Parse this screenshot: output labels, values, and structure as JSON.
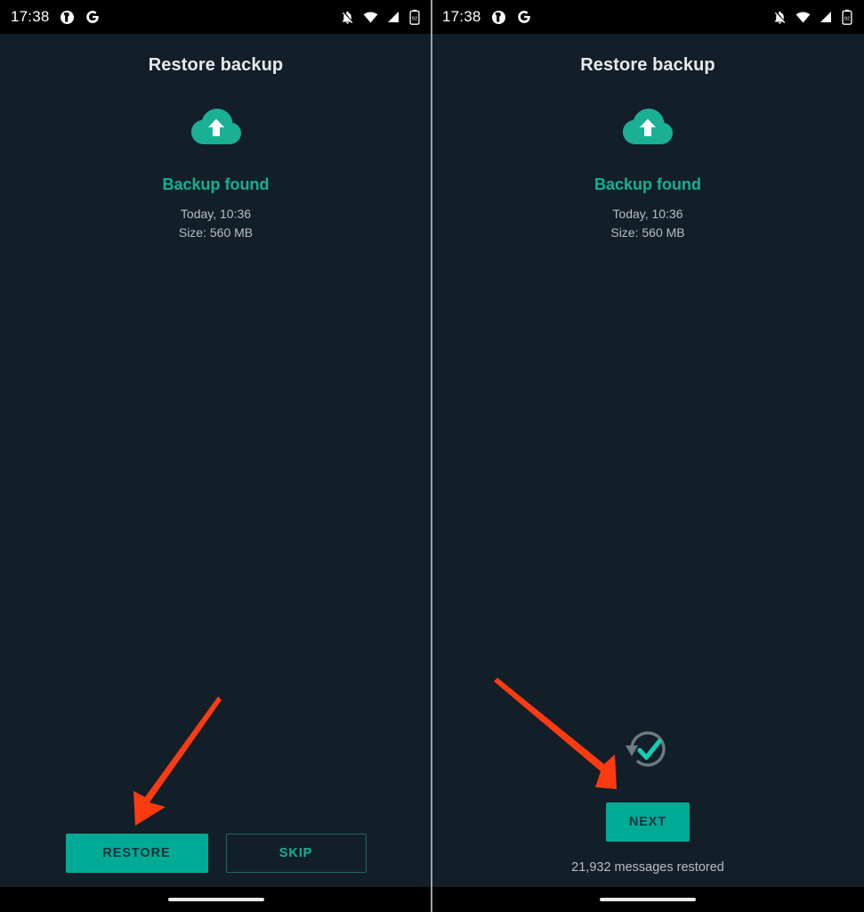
{
  "colors": {
    "background": "#121f28",
    "statusbar": "#000000",
    "accent_teal": "#00ab96",
    "accent_teal_text": "#12b195",
    "muted_text": "#b6bec2",
    "title_text": "#e8eaeb",
    "annotation_arrow": "#fc3b13",
    "divider": "#9aa3a6",
    "done_ring": "#6d7a80"
  },
  "status_bar": {
    "time": "17:38",
    "left_icons": [
      "notification-app-icon",
      "google-icon"
    ],
    "right_icons": [
      "mute-notifications-icon",
      "wifi-icon",
      "signal-icon",
      "battery-icon"
    ],
    "battery_level": "92"
  },
  "screen": {
    "title": "Restore backup",
    "cloud_icon": "cloud-upload-icon",
    "backup_status": "Backup found",
    "backup_date": "Today, 10:36",
    "backup_size": "Size: 560 MB"
  },
  "left_panel": {
    "restore_button": "RESTORE",
    "skip_button": "SKIP",
    "annotation": "arrow pointing at RESTORE button"
  },
  "right_panel": {
    "done_icon": "restore-complete-check-icon",
    "next_button": "NEXT",
    "restored_message": "21,932 messages restored",
    "annotation": "arrow pointing at NEXT button"
  },
  "navigation_bar": {
    "gesture_pill": "home-gesture-pill"
  }
}
